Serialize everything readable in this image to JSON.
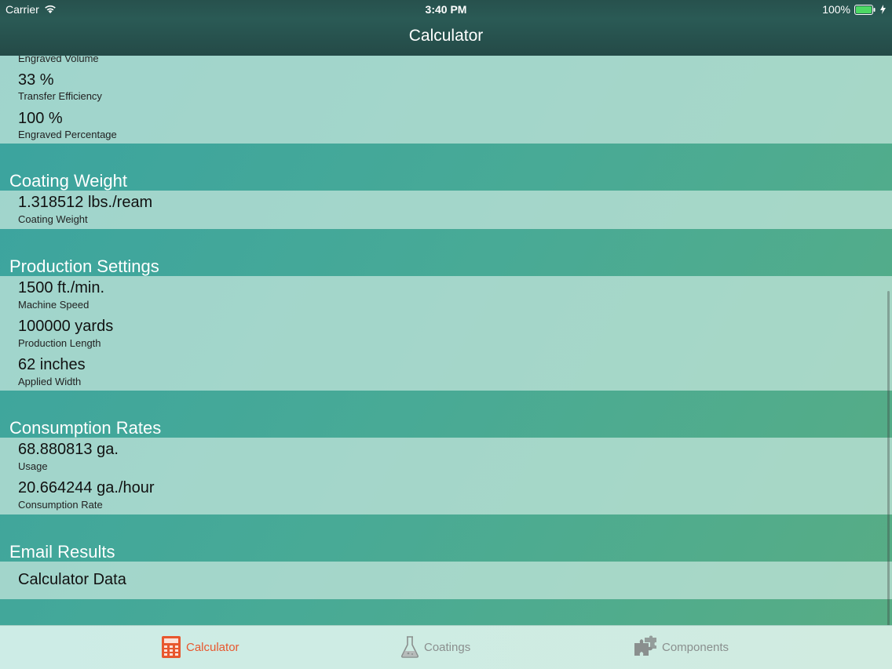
{
  "status": {
    "carrier": "Carrier",
    "time": "3:40 PM",
    "battery": "100%"
  },
  "nav": {
    "title": "Calculator"
  },
  "top_cell": {
    "partial_label": "Engraved Volume",
    "rows": [
      {
        "value": "33 %",
        "label": "Transfer Efficiency"
      },
      {
        "value": "100 %",
        "label": "Engraved Percentage"
      }
    ]
  },
  "coating_weight": {
    "header": "Coating Weight",
    "rows": [
      {
        "value": "1.318512 lbs./ream",
        "label": "Coating Weight"
      }
    ]
  },
  "production": {
    "header": "Production Settings",
    "rows": [
      {
        "value": "1500 ft./min.",
        "label": "Machine Speed"
      },
      {
        "value": "100000 yards",
        "label": "Production Length"
      },
      {
        "value": "62 inches",
        "label": "Applied Width"
      }
    ]
  },
  "consumption": {
    "header": "Consumption Rates",
    "rows": [
      {
        "value": "68.880813 ga.",
        "label": "Usage"
      },
      {
        "value": "20.664244 ga./hour",
        "label": "Consumption Rate"
      }
    ]
  },
  "email": {
    "header": "Email Results",
    "item": "Calculator Data"
  },
  "tabs": [
    {
      "label": "Calculator",
      "icon": "calculator-icon"
    },
    {
      "label": "Coatings",
      "icon": "flask-icon"
    },
    {
      "label": "Components",
      "icon": "puzzle-icon"
    }
  ],
  "colors": {
    "accent": "#e8572e",
    "inactive": "#8a8f8e"
  }
}
